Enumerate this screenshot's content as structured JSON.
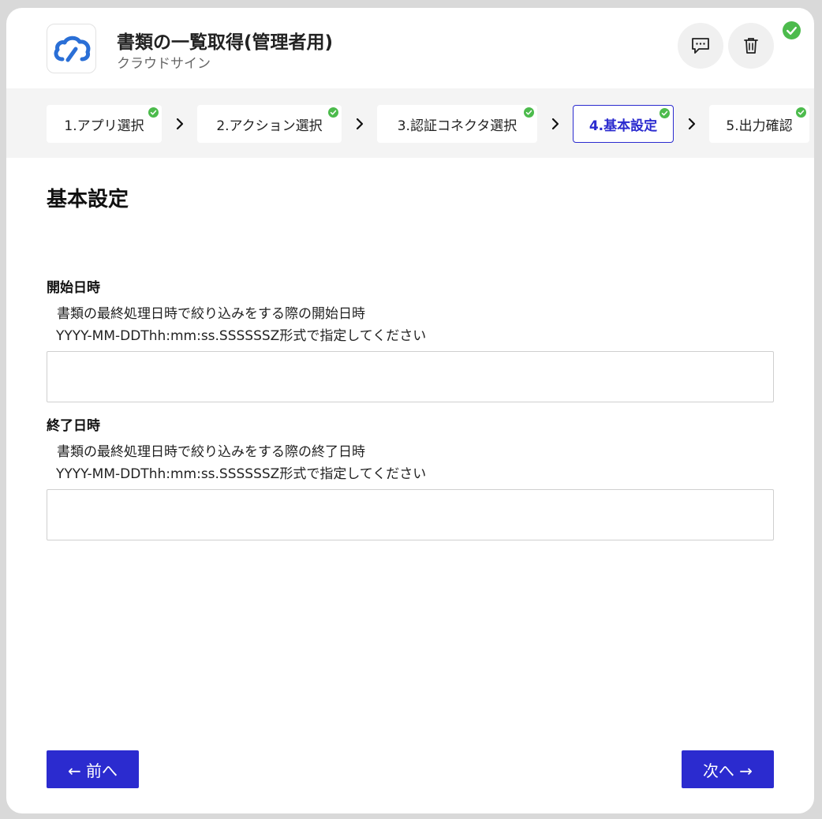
{
  "header": {
    "title": "書類の一覧取得(管理者用)",
    "subtitle": "クラウドサイン",
    "app_icon": "cloud-sign-logo",
    "status_icon": "check-circle-icon"
  },
  "steps": [
    {
      "label": "1.アプリ選択",
      "done": true
    },
    {
      "label": "2.アクション選択",
      "done": true
    },
    {
      "label": "3.認証コネクタ選択",
      "done": true
    },
    {
      "label": "4.基本設定",
      "done": true,
      "active": true
    },
    {
      "label": "5.出力確認",
      "done": true
    }
  ],
  "section": {
    "title": "基本設定"
  },
  "fields": [
    {
      "label": "開始日時",
      "help1": "書類の最終処理日時で絞り込みをする際の開始日時",
      "help2": "YYYY-MM-DDThh:mm:ss.SSSSSSZ形式で指定してください",
      "value": "",
      "placeholder": ""
    },
    {
      "label": "終了日時",
      "help1": "書類の最終処理日時で絞り込みをする際の終了日時",
      "help2": "YYYY-MM-DDThh:mm:ss.SSSSSSZ形式で指定してください",
      "value": "",
      "placeholder": ""
    }
  ],
  "footer": {
    "prev_label": "← 前へ",
    "next_label": "次へ →"
  },
  "colors": {
    "accent": "#2b2bcf",
    "success": "#4cbb4c",
    "logo_blue": "#2a6fd6"
  }
}
